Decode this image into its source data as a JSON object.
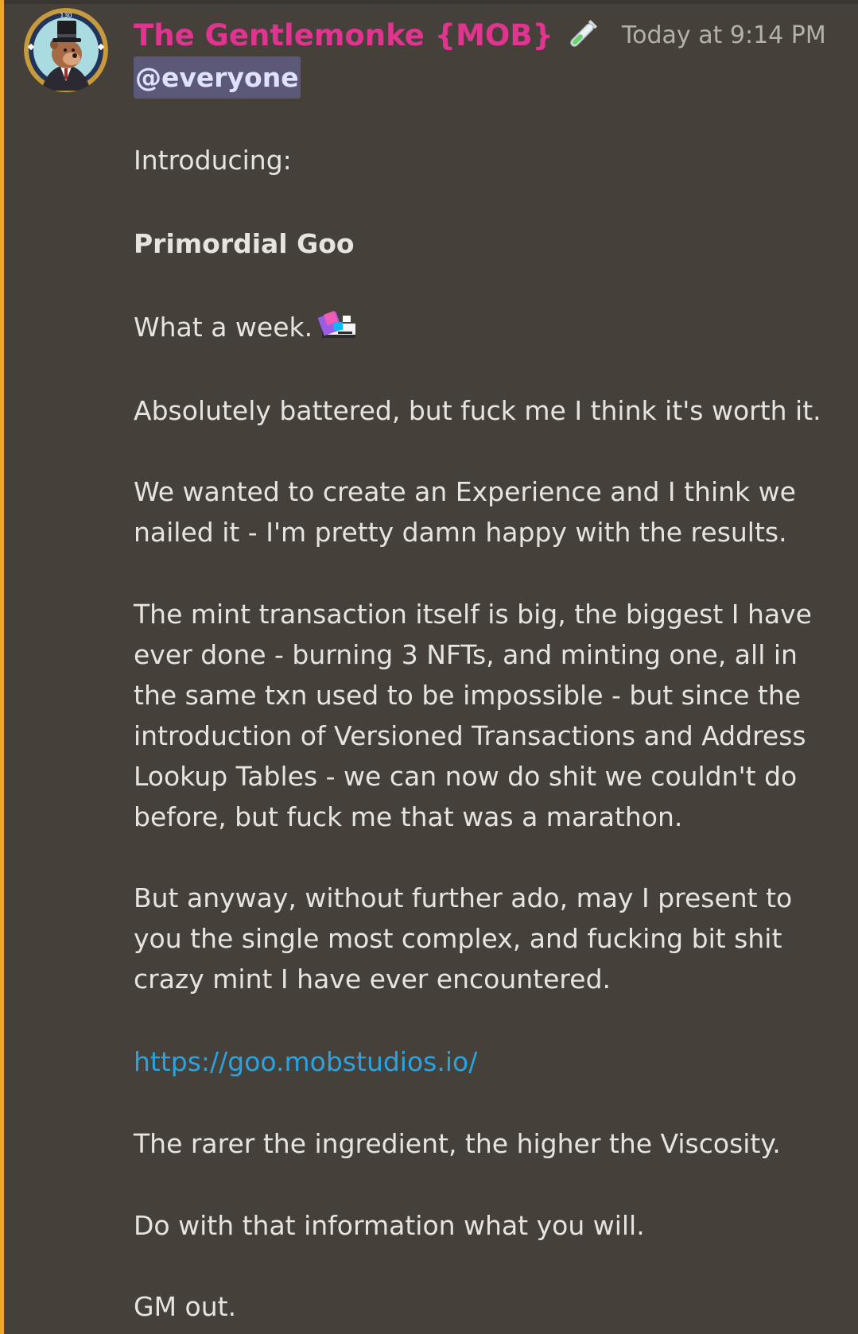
{
  "message": {
    "author": "The Gentlemonke {MOB}",
    "author_color": "#e0358f",
    "role_icon": "test-tube-icon",
    "timestamp": "Today at 9:14 PM",
    "mention": "@everyone",
    "avatar_badge": "130",
    "lines": {
      "intro": "Introducing:",
      "title": "Primordial Goo",
      "week": "What a week.",
      "week_emoji": "pixel-art-emoji",
      "battered": "Absolutely battered, but fuck me I think it's worth it.",
      "p1_l1": "We wanted to create an Experience and I think we",
      "p1_l2": "nailed it - I'm pretty damn happy with the results.",
      "p2_l1": "The mint transaction itself is big, the biggest I have",
      "p2_l2": "ever done - burning 3 NFTs, and minting one, all in",
      "p2_l3": "the same txn used to be impossible - but since the",
      "p2_l4": "introduction of Versioned Transactions and Address",
      "p2_l5": "Lookup Tables - we can now do shit we couldn't do",
      "p2_l6": "before, but fuck me that was a marathon.",
      "p3_l1": "But anyway, without further ado, may I present to",
      "p3_l2": "you the single most complex, and fucking bit shit",
      "p3_l3": "crazy mint I have ever encountered.",
      "link": "https://goo.mobstudios.io/",
      "rarer": "The rarer the ingredient, the higher the Viscosity.",
      "info": "Do with that information what you will.",
      "gm": "GM out."
    }
  },
  "colors": {
    "background": "#454039",
    "mention_bar": "#f0a52b",
    "mention_bg": "#5b5977",
    "link": "#2aa3e0",
    "timestamp": "#b4b1ab"
  }
}
